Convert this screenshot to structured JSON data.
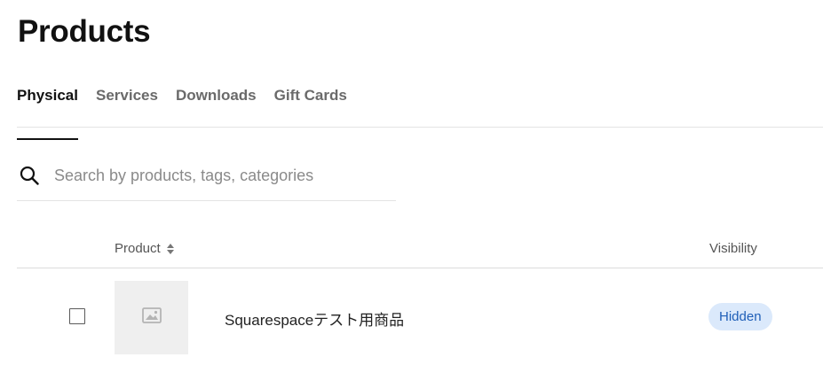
{
  "page": {
    "title": "Products"
  },
  "tabs": [
    {
      "label": "Physical",
      "active": true
    },
    {
      "label": "Services",
      "active": false
    },
    {
      "label": "Downloads",
      "active": false
    },
    {
      "label": "Gift Cards",
      "active": false
    }
  ],
  "search": {
    "placeholder": "Search by products, tags, categories",
    "value": "",
    "icon": "search-icon"
  },
  "table": {
    "columns": {
      "product": "Product",
      "visibility": "Visibility"
    },
    "sort_icon": "sort-icon",
    "rows": [
      {
        "name": "Squarespaceテスト用商品",
        "visibility": "Hidden",
        "selected": false,
        "thumbnail_icon": "image-placeholder-icon"
      }
    ]
  },
  "colors": {
    "text_primary": "#111111",
    "text_muted": "#6a6a6a",
    "divider": "#e3e3e3",
    "badge_bg": "#dbe9fb",
    "badge_text": "#1f5fb8",
    "thumb_bg": "#efefef"
  }
}
